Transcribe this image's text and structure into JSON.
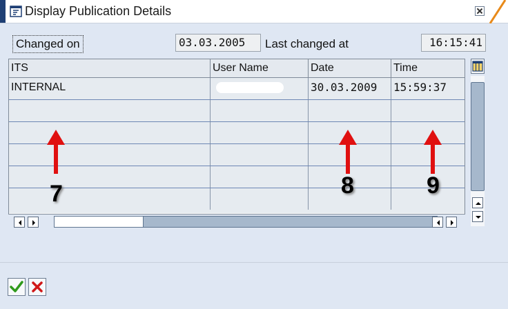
{
  "window": {
    "title": "Display Publication Details"
  },
  "fields": {
    "changed_on_label": "Changed on",
    "changed_on_value": "03.03.2005",
    "last_changed_label": "Last changed at",
    "last_changed_value": "16:15:41"
  },
  "table": {
    "columns": [
      "ITS",
      "User Name",
      "Date",
      "Time"
    ],
    "rows": [
      {
        "its": "INTERNAL",
        "user": "",
        "date": "30.03.2009",
        "time": "15:59:37"
      }
    ]
  },
  "annotations": {
    "its_marker": "7",
    "date_marker": "8",
    "time_marker": "9"
  },
  "colors": {
    "accent": "#1e3f74",
    "title_slant": "#e88a1a",
    "annotation_arrow": "#e01010",
    "confirm": "#2f9a1c",
    "cancel": "#d01818"
  },
  "footer": {
    "confirm_icon": "checkmark-icon",
    "cancel_icon": "cross-icon"
  }
}
